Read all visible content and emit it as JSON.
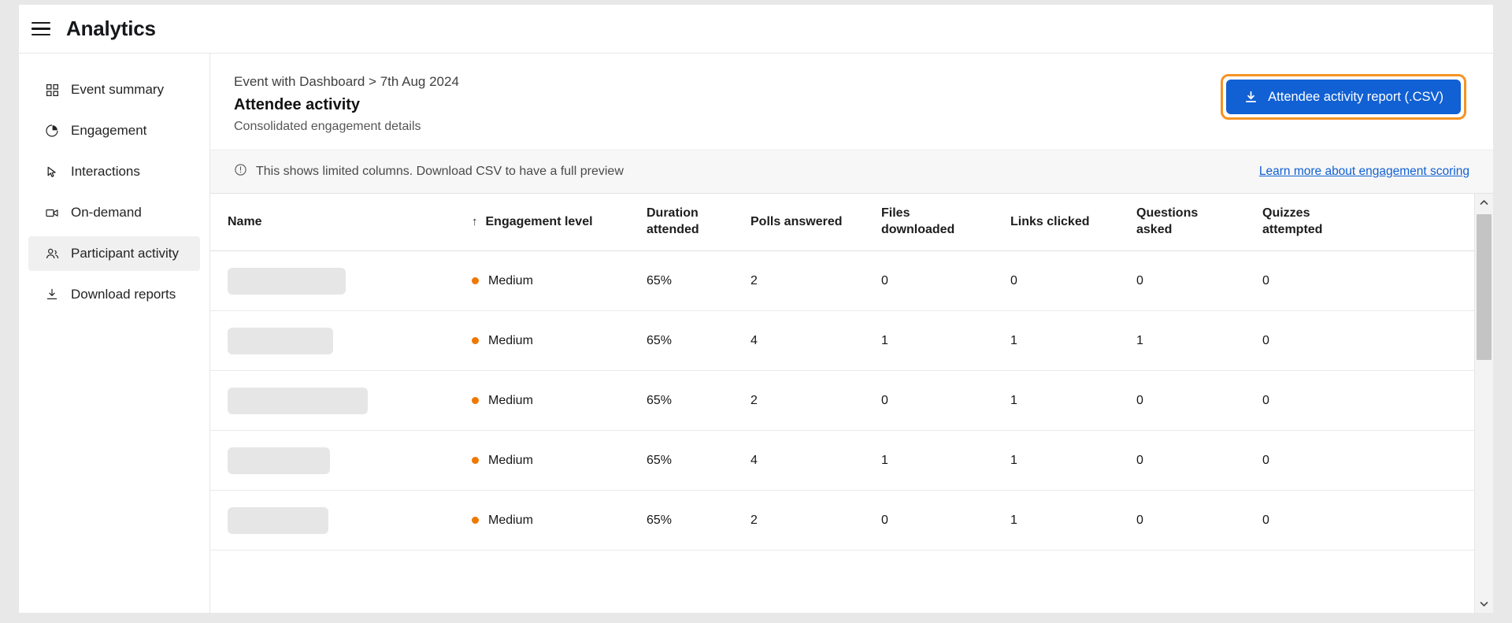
{
  "app": {
    "title": "Analytics",
    "menu_icon": "hamburger-menu-icon"
  },
  "sidebar": {
    "items": [
      {
        "label": "Event summary",
        "icon": "grid-icon",
        "active": false
      },
      {
        "label": "Engagement",
        "icon": "pie-chart-icon",
        "active": false
      },
      {
        "label": "Interactions",
        "icon": "cursor-icon",
        "active": false
      },
      {
        "label": "On-demand",
        "icon": "video-icon",
        "active": false
      },
      {
        "label": "Participant activity",
        "icon": "people-icon",
        "active": true
      },
      {
        "label": "Download reports",
        "icon": "download-icon",
        "active": false
      }
    ]
  },
  "header": {
    "breadcrumb": "Event with Dashboard > 7th Aug 2024",
    "title": "Attendee activity",
    "subtitle": "Consolidated engagement details",
    "download_button": {
      "label": "Attendee activity report (.CSV)",
      "icon": "download-icon",
      "bg_color": "#1160d4",
      "focus_ring_color": "#f59324"
    }
  },
  "notice": {
    "icon": "info-circle-icon",
    "text": "This shows limited columns. Download CSV to have a full preview",
    "link_label": "Learn more about engagement scoring",
    "link_color": "#1160d4"
  },
  "table": {
    "sort": {
      "column": "Engagement level",
      "direction": "asc",
      "arrow": "↑"
    },
    "columns": [
      {
        "key": "name",
        "label": "Name"
      },
      {
        "key": "eng",
        "label": "Engagement level"
      },
      {
        "key": "dur",
        "label": "Duration attended"
      },
      {
        "key": "polls",
        "label": "Polls answered"
      },
      {
        "key": "files",
        "label": "Files downloaded"
      },
      {
        "key": "links",
        "label": "Links clicked"
      },
      {
        "key": "quest",
        "label": "Questions asked"
      },
      {
        "key": "quiz",
        "label": "Quizzes attempted"
      }
    ],
    "column_labels": {
      "name": "Name",
      "eng": "Engagement level",
      "dur_l1": "Duration",
      "dur_l2": "attended",
      "polls": "Polls answered",
      "files_l1": "Files",
      "files_l2": "downloaded",
      "links": "Links clicked",
      "quest_l1": "Questions",
      "quest_l2": "asked",
      "quiz_l1": "Quizzes",
      "quiz_l2": "attempted"
    },
    "engagement_dot_color": "#f07800",
    "rows": [
      {
        "name_redacted_width": 150,
        "engagement": "Medium",
        "duration": "65%",
        "polls": "2",
        "files": "0",
        "links": "0",
        "questions": "0",
        "quizzes": "0"
      },
      {
        "name_redacted_width": 134,
        "engagement": "Medium",
        "duration": "65%",
        "polls": "4",
        "files": "1",
        "links": "1",
        "questions": "1",
        "quizzes": "0"
      },
      {
        "name_redacted_width": 178,
        "engagement": "Medium",
        "duration": "65%",
        "polls": "2",
        "files": "0",
        "links": "1",
        "questions": "0",
        "quizzes": "0"
      },
      {
        "name_redacted_width": 130,
        "engagement": "Medium",
        "duration": "65%",
        "polls": "4",
        "files": "1",
        "links": "1",
        "questions": "0",
        "quizzes": "0"
      },
      {
        "name_redacted_width": 128,
        "engagement": "Medium",
        "duration": "65%",
        "polls": "2",
        "files": "0",
        "links": "1",
        "questions": "0",
        "quizzes": "0"
      }
    ]
  },
  "scrollbar": {
    "up_arrow": "chevron-up-icon",
    "down_arrow": "chevron-down-icon"
  }
}
